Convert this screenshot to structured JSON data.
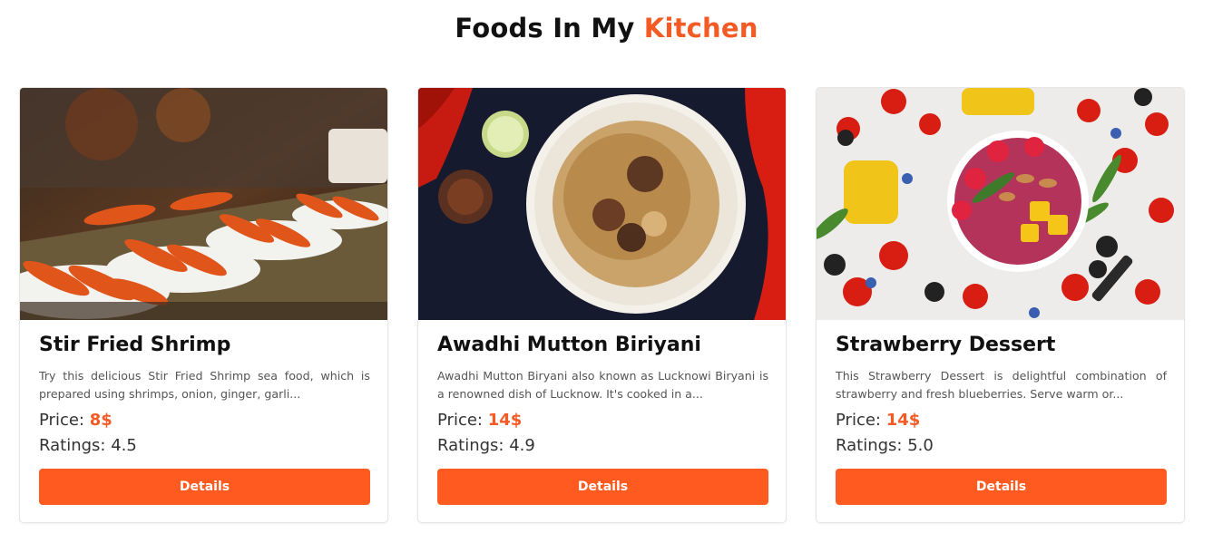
{
  "header": {
    "title_prefix": "Foods In My",
    "title_accent": "Kitchen",
    "accent_color": "#f45a24"
  },
  "cards": [
    {
      "title": "Stir Fried Shrimp",
      "description": "Try this delicious Stir Fried Shrimp sea food, which is prepared using shrimps, onion, ginger, garli...",
      "price_label": "Price:",
      "price": "8$",
      "rating_label": "Ratings:",
      "rating": "4.5",
      "button_label": "Details",
      "image_icon": "shrimp-food-photo"
    },
    {
      "title": "Awadhi Mutton Biriyani",
      "description": "Awadhi Mutton Biryani also known as Lucknowi Biryani is a renowned dish of Lucknow. It's cooked in a...",
      "price_label": "Price:",
      "price": "14$",
      "rating_label": "Ratings:",
      "rating": "4.9",
      "button_label": "Details",
      "image_icon": "biryani-food-photo"
    },
    {
      "title": "Strawberry Dessert",
      "description": "This Strawberry Dessert is delightful combination of strawberry and fresh blueberries. Serve warm or...",
      "price_label": "Price:",
      "price": "14$",
      "rating_label": "Ratings:",
      "rating": "5.0",
      "button_label": "Details",
      "image_icon": "strawberry-dessert-photo"
    }
  ],
  "colors": {
    "button": "#ff5a1f",
    "price": "#f45a24"
  }
}
